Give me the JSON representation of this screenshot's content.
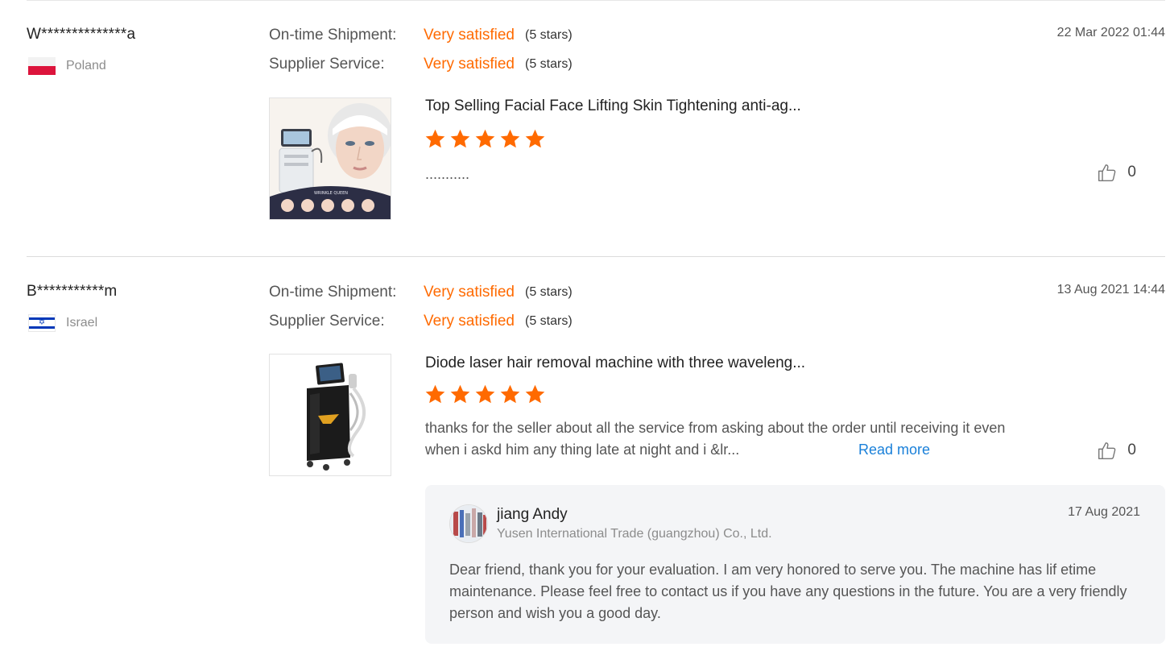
{
  "reviews": [
    {
      "buyer": "W**************a",
      "country": "Poland",
      "shipment_label": "On-time Shipment:",
      "shipment_value": "Very satisfied",
      "shipment_stars": "(5 stars)",
      "service_label": "Supplier Service:",
      "service_value": "Very satisfied",
      "service_stars": "(5 stars)",
      "date": "22 Mar 2022 01:44",
      "product_title": "Top Selling Facial Face Lifting Skin Tightening anti-ag...",
      "product_image_text": "WRINKLE QUEEN",
      "rating": 5,
      "comment": "...........",
      "likes": "0"
    },
    {
      "buyer": "B***********m",
      "country": "Israel",
      "shipment_label": "On-time Shipment:",
      "shipment_value": "Very satisfied",
      "shipment_stars": "(5 stars)",
      "service_label": "Supplier Service:",
      "service_value": "Very satisfied",
      "service_stars": "(5 stars)",
      "date": "13 Aug 2021 14:44",
      "product_title": "Diode laser hair removal machine with three waveleng...",
      "rating": 5,
      "comment_line1": "thanks for the seller about all the service from asking about the order until receiving it even",
      "comment_line2": "when i askd him any thing late at night and i &lr...",
      "read_more": "Read more",
      "likes": "0",
      "reply": {
        "name": "jiang Andy",
        "company": "Yusen International Trade (guangzhou) Co., Ltd.",
        "date": "17 Aug 2021",
        "text": "Dear friend, thank you for your evaluation. I am very honored to serve you. The machine has lif etime maintenance. Please feel free to contact us if you have any questions in the future. You are a very friendly person and wish you a good day."
      }
    }
  ],
  "colors": {
    "accent": "#ff6a00",
    "link": "#1a80d9",
    "reply_bg": "#f4f5f7"
  },
  "icons": [
    "thumbs-up-icon",
    "star-icon",
    "flag-poland-icon",
    "flag-israel-icon",
    "avatar"
  ]
}
